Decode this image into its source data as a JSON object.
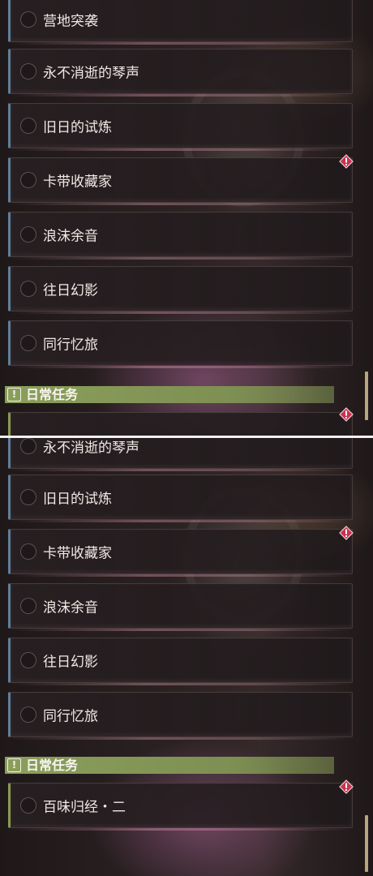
{
  "top_panel": {
    "quests": [
      {
        "name": "营地突袭",
        "alert": false
      },
      {
        "name": "永不消逝的琴声",
        "alert": false
      },
      {
        "name": "旧日的试炼",
        "alert": false
      },
      {
        "name": "卡带收藏家",
        "alert": true
      },
      {
        "name": "浪沫余音",
        "alert": false
      },
      {
        "name": "往日幻影",
        "alert": false
      },
      {
        "name": "同行忆旅",
        "alert": false
      }
    ],
    "section_header": "日常任务",
    "section_icon": "exclamation-box-icon"
  },
  "bottom_panel": {
    "quests": [
      {
        "name": "永不消逝的琴声",
        "alert": false
      },
      {
        "name": "旧日的试炼",
        "alert": false
      },
      {
        "name": "卡带收藏家",
        "alert": true
      },
      {
        "name": "浪沫余音",
        "alert": false
      },
      {
        "name": "往日幻影",
        "alert": false
      },
      {
        "name": "同行忆旅",
        "alert": false
      }
    ],
    "section_header": "日常任务",
    "daily_quests": [
      {
        "name": "百味归经・二",
        "alert": true
      }
    ]
  },
  "colors": {
    "main_quest_accent": "#5f7f99",
    "daily_accent": "#8b9f5c",
    "alert_red": "#c8324f"
  }
}
